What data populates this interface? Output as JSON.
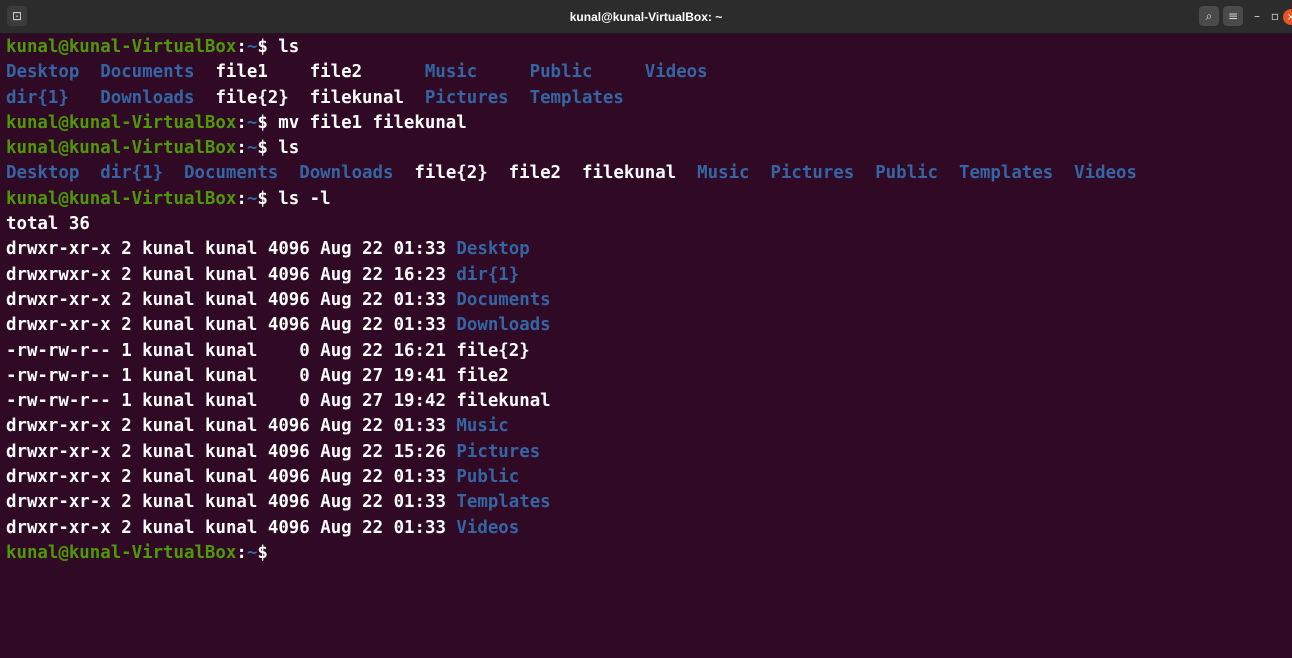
{
  "window": {
    "title": "kunal@kunal-VirtualBox: ~",
    "buttons": {
      "new_tab": "⊡",
      "search": "⌕",
      "menu": "≡",
      "minimize": "–",
      "maximize": "▫",
      "close": "×"
    }
  },
  "colors": {
    "background": "#300a24",
    "prompt_user": "#4e9a06",
    "directory": "#3465a4",
    "text": "#ffffff",
    "close_button": "#e95420"
  },
  "terminal": {
    "lines": [
      {
        "type": "prompt",
        "user": "kunal@kunal-VirtualBox",
        "sep": ":",
        "path": "~",
        "symbol": "$ ",
        "command": "ls"
      },
      {
        "type": "output",
        "text": "Desktop  Documents  file1    file2      Music     Public     Videos"
      },
      {
        "type": "output",
        "text": "dir{1}   Downloads  file{2}  filekunal  Pictures  Templates"
      },
      {
        "type": "prompt",
        "user": "kunal@kunal-VirtualBox",
        "sep": ":",
        "path": "~",
        "symbol": "$ ",
        "command": "mv file1 filekunal"
      },
      {
        "type": "prompt",
        "user": "kunal@kunal-VirtualBox",
        "sep": ":",
        "path": "~",
        "symbol": "$ ",
        "command": "ls"
      },
      {
        "type": "output",
        "text": "Desktop  dir{1}  Documents  Downloads  file{2}  file2  filekunal  Music  Pictures  Public  Templates  Videos"
      },
      {
        "type": "prompt",
        "user": "kunal@kunal-VirtualBox",
        "sep": ":",
        "path": "~",
        "symbol": "$ ",
        "command": "ls -l"
      },
      {
        "type": "output",
        "text": "total 36"
      },
      {
        "type": "output",
        "text": "drwxr-xr-x 2 kunal kunal 4096 Aug 22 01:33 Desktop"
      },
      {
        "type": "output",
        "text": "drwxrwxr-x 2 kunal kunal 4096 Aug 22 16:23 dir{1}"
      },
      {
        "type": "output",
        "text": "drwxr-xr-x 2 kunal kunal 4096 Aug 22 01:33 Documents"
      },
      {
        "type": "output",
        "text": "drwxr-xr-x 2 kunal kunal 4096 Aug 22 01:33 Downloads"
      },
      {
        "type": "output",
        "text": "-rw-rw-r-- 1 kunal kunal    0 Aug 22 16:21 file{2}"
      },
      {
        "type": "output",
        "text": "-rw-rw-r-- 1 kunal kunal    0 Aug 27 19:41 file2"
      },
      {
        "type": "output",
        "text": "-rw-rw-r-- 1 kunal kunal    0 Aug 27 19:42 filekunal"
      },
      {
        "type": "output",
        "text": "drwxr-xr-x 2 kunal kunal 4096 Aug 22 01:33 Music"
      },
      {
        "type": "output",
        "text": "drwxr-xr-x 2 kunal kunal 4096 Aug 22 15:26 Pictures"
      },
      {
        "type": "output",
        "text": "drwxr-xr-x 2 kunal kunal 4096 Aug 22 01:33 Public"
      },
      {
        "type": "output",
        "text": "drwxr-xr-x 2 kunal kunal 4096 Aug 22 01:33 Templates"
      },
      {
        "type": "output",
        "text": "drwxr-xr-x 2 kunal kunal 4096 Aug 22 01:33 Videos"
      },
      {
        "type": "prompt",
        "user": "kunal@kunal-VirtualBox",
        "sep": ":",
        "path": "~",
        "symbol": "$ ",
        "command": ""
      }
    ]
  }
}
